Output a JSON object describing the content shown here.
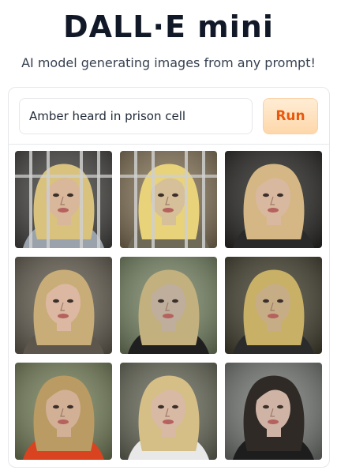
{
  "header": {
    "title": "DALL·E mini",
    "subtitle": "AI model generating images from any prompt!"
  },
  "prompt": {
    "value": "Amber heard in prison cell",
    "placeholder": ""
  },
  "run_button": {
    "label": "Run"
  },
  "colors": {
    "accent": "#ea580c",
    "button_bg": "#fed7aa",
    "border": "#e5e7eb"
  },
  "gallery": {
    "images": [
      {
        "bg": "#4b4a47",
        "hair": "#d9c27e",
        "skin": "#d8b79a",
        "clothing": "#9aa3ab",
        "bars": true
      },
      {
        "bg": "#8a7a5e",
        "hair": "#e8d27a",
        "skin": "#d6c09a",
        "clothing": "#6f6a57",
        "bars": true
      },
      {
        "bg": "#2f2e2b",
        "hair": "#d4b784",
        "skin": "#d9b8a0",
        "clothing": "#2a2a2a",
        "bars": false
      },
      {
        "bg": "#6b6457",
        "hair": "#c9ad78",
        "skin": "#dcb8a2",
        "clothing": "#5c564c",
        "bars": false
      },
      {
        "bg": "#7d8a6a",
        "hair": "#c2b07e",
        "skin": "#bfae9c",
        "clothing": "#1f1f1f",
        "bars": false
      },
      {
        "bg": "#4a4636",
        "hair": "#c8b067",
        "skin": "#c6ad86",
        "clothing": "#2b2b2b",
        "bars": false
      },
      {
        "bg": "#7b8560",
        "hair": "#b99b63",
        "skin": "#d2b096",
        "clothing": "#d9431f",
        "bars": false
      },
      {
        "bg": "#6f7060",
        "hair": "#d5bf86",
        "skin": "#d8b9a4",
        "clothing": "#e8e8e8",
        "bars": false
      },
      {
        "bg": "#7a7d7a",
        "hair": "#2f2a26",
        "skin": "#cfb4a6",
        "clothing": "#1d1d1d",
        "bars": false
      }
    ]
  }
}
